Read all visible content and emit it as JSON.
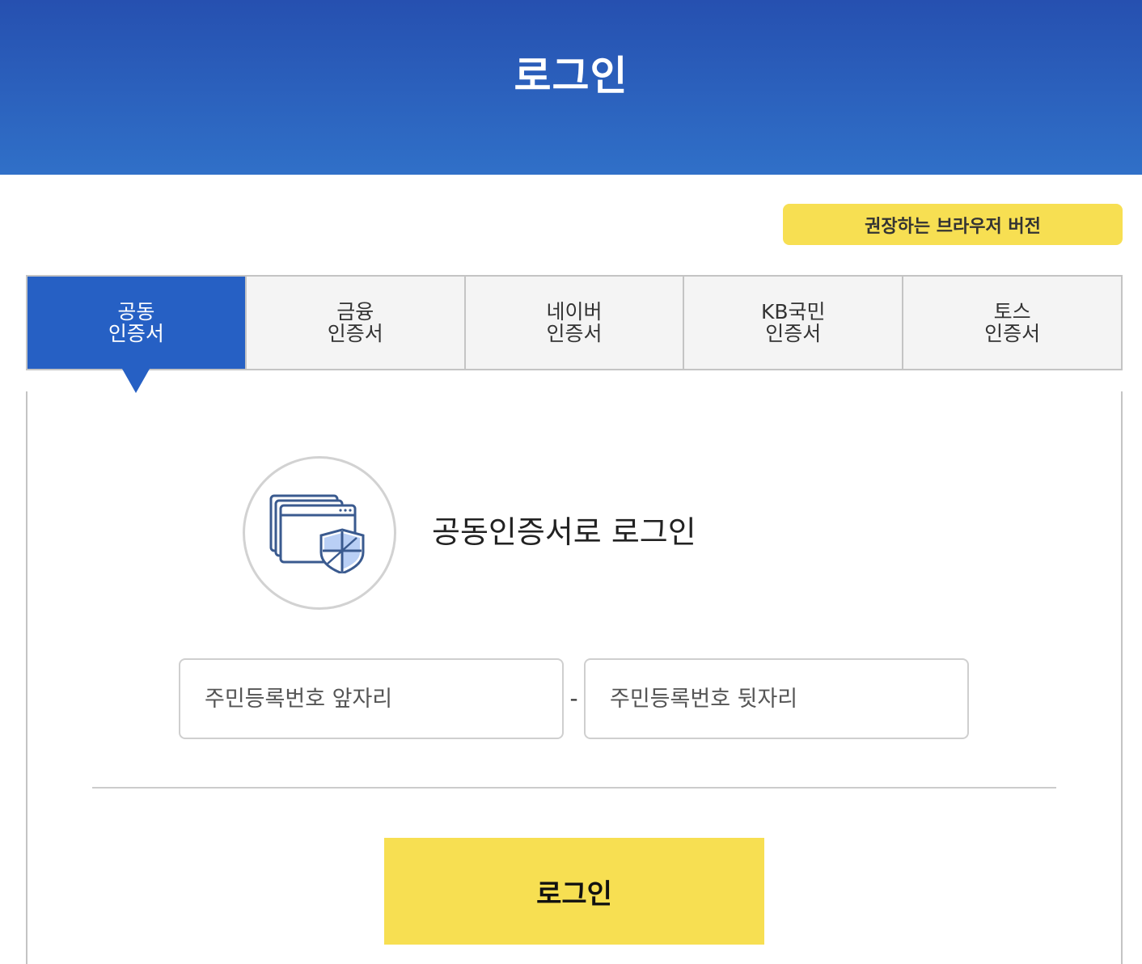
{
  "header": {
    "title": "로그인"
  },
  "browser_button": {
    "label": "권장하는 브라우저 버전"
  },
  "tabs": [
    {
      "line1": "공동",
      "line2": "인증서",
      "active": true
    },
    {
      "line1": "금융",
      "line2": "인증서",
      "active": false
    },
    {
      "line1": "네이버",
      "line2": "인증서",
      "active": false
    },
    {
      "line1": "KB국민",
      "line2": "인증서",
      "active": false
    },
    {
      "line1": "토스",
      "line2": "인증서",
      "active": false
    }
  ],
  "panel": {
    "heading": "공동인증서로 로그인",
    "icon": "certificate-shield-icon",
    "id_front": {
      "placeholder": "주민등록번호 앞자리",
      "value": ""
    },
    "separator": "-",
    "id_back": {
      "placeholder": "주민등록번호 뒷자리",
      "value": ""
    },
    "login_label": "로그인"
  },
  "colors": {
    "header_top": "#2650b0",
    "header_bottom": "#3070c8",
    "tab_active": "#2660c4",
    "accent_yellow": "#f7df52"
  }
}
